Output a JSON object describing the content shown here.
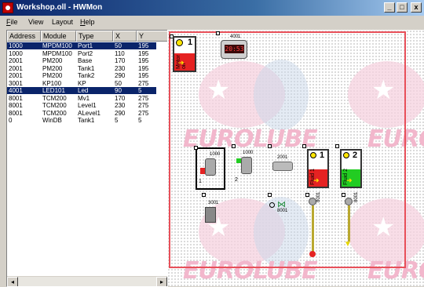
{
  "window": {
    "title": "Workshop.oll - HWMon"
  },
  "titlebar_buttons": {
    "min": "_",
    "max": "□",
    "close": "x"
  },
  "menu": [
    {
      "label": "File",
      "u": "F",
      "rest": "ile"
    },
    {
      "label": "View"
    },
    {
      "label": "Layout"
    },
    {
      "label": "Help",
      "u": "H",
      "rest": "elp"
    }
  ],
  "list": {
    "columns": [
      "Address",
      "Module",
      "Type",
      "X",
      "Y"
    ],
    "rows": [
      [
        "1000",
        "MPDM100",
        "Port1",
        "50",
        "195"
      ],
      [
        "1000",
        "MPDM100",
        "Port2",
        "110",
        "195"
      ],
      [
        "2001",
        "PM200",
        "Base",
        "170",
        "195"
      ],
      [
        "2001",
        "PM200",
        "Tank1",
        "230",
        "195"
      ],
      [
        "2001",
        "PM200",
        "Tank2",
        "290",
        "195"
      ],
      [
        "3001",
        "KP100",
        "KP",
        "50",
        "275"
      ],
      [
        "4001",
        "LED101",
        "Led",
        "90",
        "5"
      ],
      [
        "8001",
        "TCM200",
        "Mv1",
        "170",
        "275"
      ],
      [
        "8001",
        "TCM200",
        "Level1",
        "230",
        "275"
      ],
      [
        "8001",
        "TCM200",
        "ALevel1",
        "290",
        "275"
      ],
      [
        "0",
        "WinDB",
        "Tank1",
        "5",
        "5"
      ]
    ],
    "selected_rows": [
      0,
      6
    ]
  },
  "canvas": {
    "watermark": "EUROLUBE",
    "watermark_partial": "EURO",
    "led_clock": "20:53",
    "led_address": "4001",
    "tank_labels": {
      "tank_top": "1",
      "tank_mid1": "1",
      "tank_mid2": "2",
      "tank_top_side": "Motor oil",
      "tank_mid1_side": "Fluid 1",
      "tank_mid2_side": "Fluid 2"
    },
    "device_labels": {
      "port1_addr": "1000",
      "port1_num": "1",
      "port2_addr": "1000",
      "port2_num": "2",
      "pm_addr": "2001",
      "kp_addr": "3001",
      "mv_addr": "8001",
      "level1_addr": "8001",
      "alevel1_addr": "8001"
    },
    "colors": {
      "tank_red": "#e52222",
      "tank_green": "#22cc22",
      "selection": "#e8505a",
      "selected_row": "#0a246a"
    }
  }
}
